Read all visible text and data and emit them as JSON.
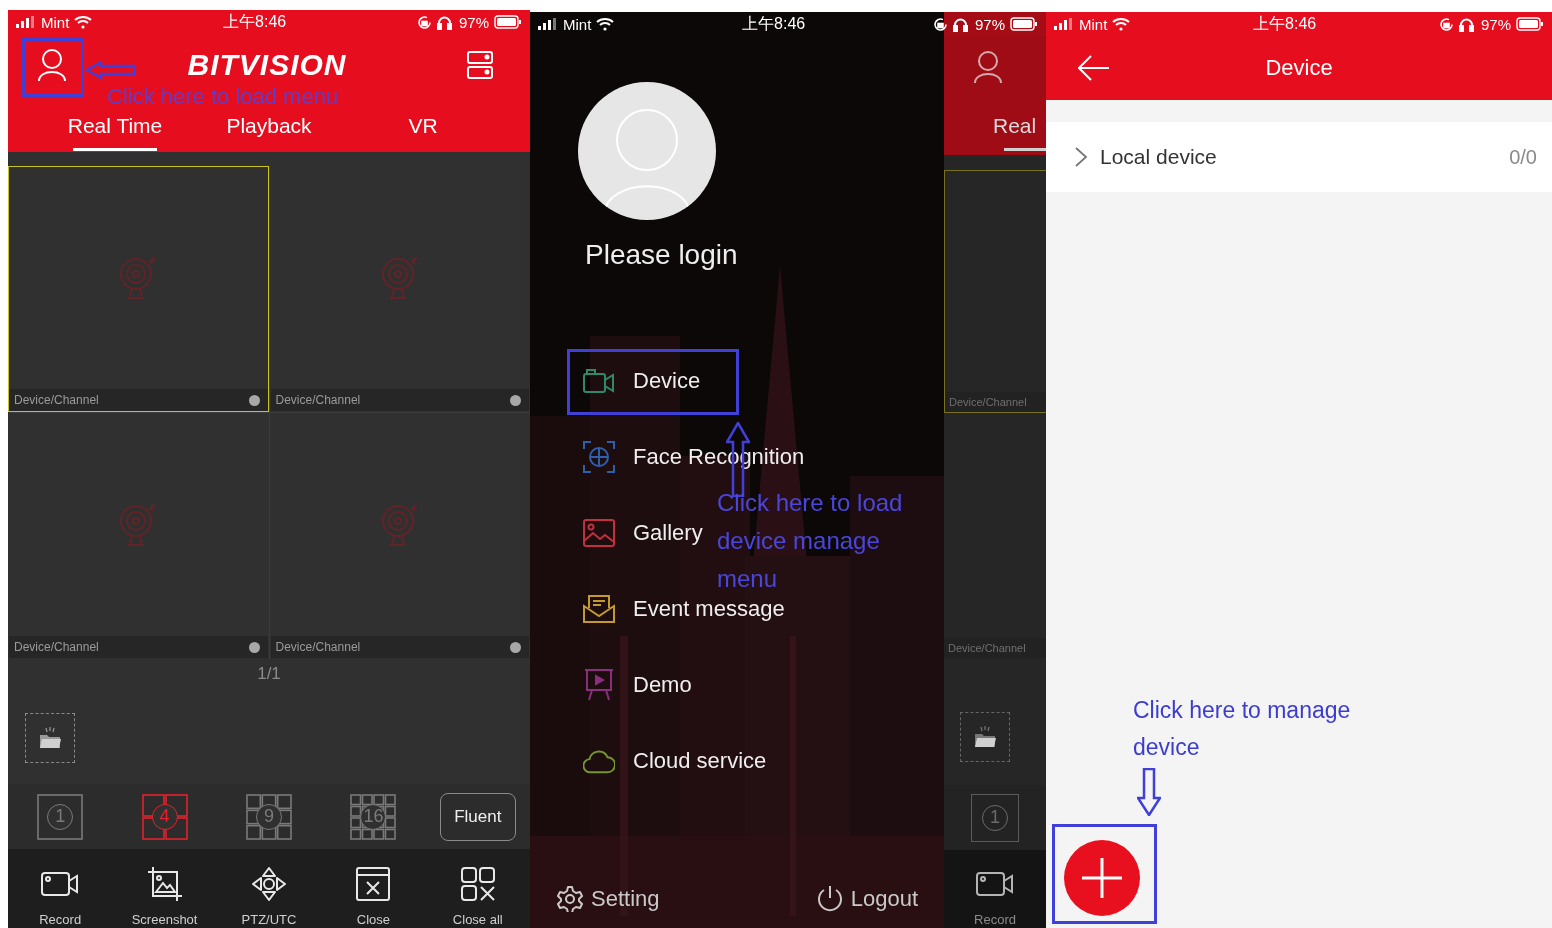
{
  "live_view": {
    "status_bar": {
      "carrier": "Mint",
      "time": "上午8:46",
      "battery": "97%"
    },
    "title": "BITVISION",
    "tabs": [
      {
        "label": "Real Time",
        "selected": true
      },
      {
        "label": "Playback",
        "selected": false
      },
      {
        "label": "VR",
        "selected": false
      }
    ],
    "tiles": [
      {
        "label": "Device/Channel",
        "selected": true
      },
      {
        "label": "Device/Channel",
        "selected": false
      },
      {
        "label": "Device/Channel",
        "selected": false
      },
      {
        "label": "Device/Channel",
        "selected": false
      }
    ],
    "page": "1/1",
    "layouts": [
      {
        "kind": "single",
        "label": "1",
        "selected": false
      },
      {
        "kind": "quad",
        "label": "4",
        "selected": true
      },
      {
        "kind": "ninefold",
        "label": "9",
        "selected": false
      },
      {
        "kind": "sixteenfold",
        "label": "16",
        "selected": false
      },
      {
        "kind": "text",
        "label": "Fluent",
        "selected": false
      }
    ],
    "tools": [
      {
        "kind": "record",
        "label": "Record"
      },
      {
        "kind": "screenshot",
        "label": "Screenshot"
      },
      {
        "kind": "ptz",
        "label": "PTZ/UTC"
      },
      {
        "kind": "close",
        "label": "Close"
      },
      {
        "kind": "closeall",
        "label": "Close all"
      }
    ],
    "note": {
      "lines": [
        "Click here to load menu"
      ]
    }
  },
  "side_menu": {
    "status_bar": {
      "carrier": "Mint",
      "time": "上午8:46",
      "battery": "97%"
    },
    "login": "Please login",
    "items": [
      {
        "kind": "device",
        "label": "Device",
        "color": "#2f8a6c"
      },
      {
        "kind": "face",
        "label": "Face Recognition",
        "color": "#2c5fae"
      },
      {
        "kind": "gallery",
        "label": "Gallery",
        "color": "#c0303e"
      },
      {
        "kind": "event",
        "label": "Event message",
        "color": "#c49a30"
      },
      {
        "kind": "demo",
        "label": "Demo",
        "color": "#8a2f7e"
      },
      {
        "kind": "cloud",
        "label": "Cloud service",
        "color": "#76962e"
      }
    ],
    "footer": [
      {
        "kind": "setting",
        "label": "Setting"
      },
      {
        "kind": "logout",
        "label": "Logout"
      }
    ],
    "note": {
      "lines": [
        "Click here to load",
        "device manage",
        "menu"
      ]
    },
    "behind": {
      "tab": "Real",
      "tiles": [
        "Device/Channel",
        "Device/Channel"
      ],
      "layout": "1",
      "tool": "Record"
    }
  },
  "device_list": {
    "status_bar": {
      "carrier": "Mint",
      "time": "上午8:46",
      "battery": "97%"
    },
    "title": "Device",
    "groups": [
      {
        "label": "Local device",
        "count": "0/0",
        "expanded": false
      }
    ],
    "note": {
      "lines": [
        "Click here to manage",
        "device"
      ]
    }
  }
}
